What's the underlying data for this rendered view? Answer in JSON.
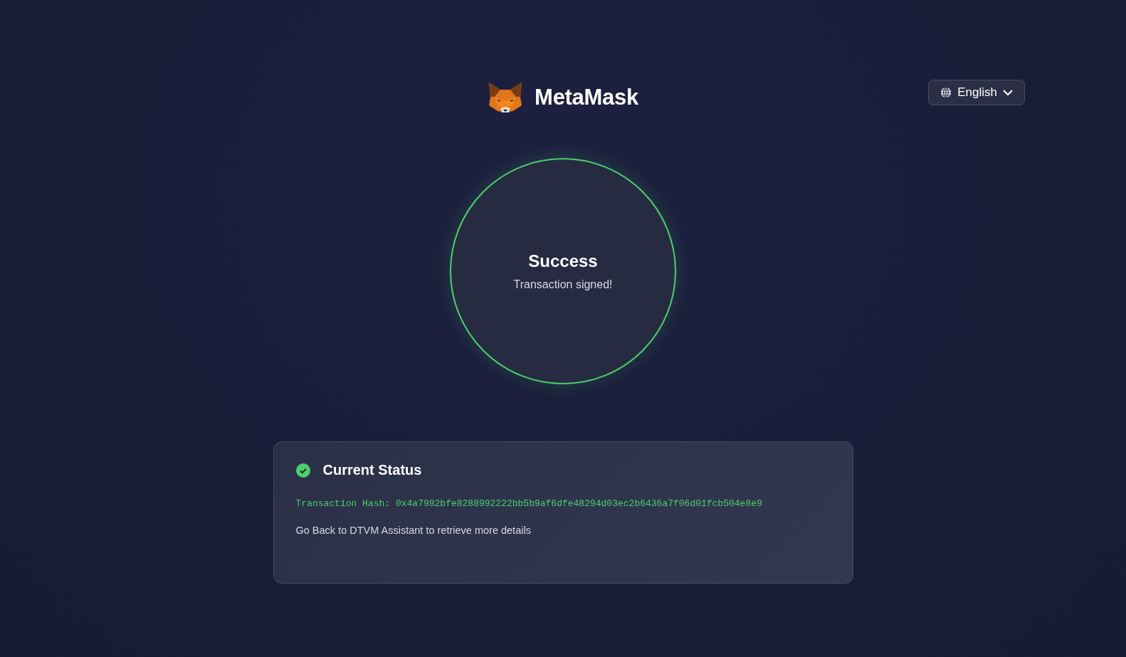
{
  "header": {
    "brand": "MetaMask",
    "language": "English"
  },
  "result": {
    "kind": "success",
    "title": "Success",
    "message": "Transaction signed!"
  },
  "status_card": {
    "kind": "success",
    "title": "Current Status",
    "hash_line": "Transaction Hash: 0x4a7982bfe8288992222bb5b9af6dfe48294d03ec2b6436a7f06d01fcb504e8e9",
    "note": "Go Back to DTVM Assistant to retrieve more details"
  }
}
